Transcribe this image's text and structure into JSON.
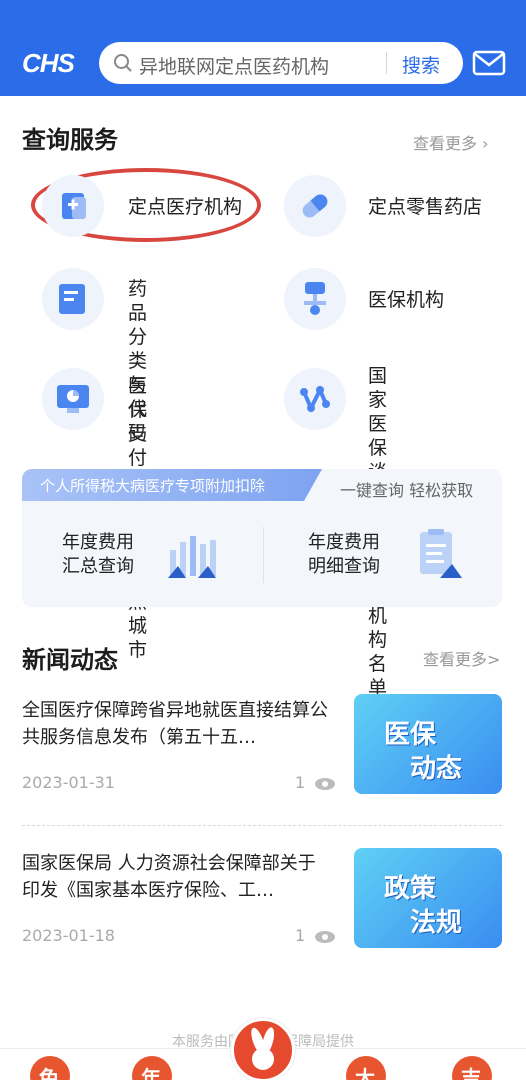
{
  "header": {
    "logo": "CHS",
    "search_placeholder": "异地联网定点医药机构",
    "search_button": "搜索"
  },
  "query": {
    "title": "查询服务",
    "more": "查看更多 ›",
    "items": [
      {
        "label": "定点医疗机构"
      },
      {
        "label": "定点零售药店"
      },
      {
        "label_l1": "药品分类与代",
        "label_l2": "码"
      },
      {
        "label": "医保机构"
      },
      {
        "label_l1": "医保支付方式",
        "label_l2": "改革试点城市"
      },
      {
        "label_l1": "国家医保谈判",
        "label_l2": "药品配备机构",
        "label_l3": "名单查询"
      }
    ]
  },
  "tax": {
    "banner": "个人所得税大病医疗专项附加扣除",
    "sub": "一键查询 轻松获取",
    "items": [
      {
        "l1": "年度费用",
        "l2": "汇总查询"
      },
      {
        "l1": "年度费用",
        "l2": "明细查询"
      }
    ]
  },
  "news": {
    "title": "新闻动态",
    "more": "查看更多>",
    "items": [
      {
        "title": "全国医疗保障跨省异地就医直接结算公共服务信息发布（第五十五…",
        "date": "2023-01-31",
        "views": "1",
        "thumb_l1": "医保",
        "thumb_l2": "动态"
      },
      {
        "title": "国家医保局 人力资源社会保障部关于印发《国家基本医疗保险、工…",
        "date": "2023-01-18",
        "views": "1",
        "thumb_l1": "政策",
        "thumb_l2": "法规"
      }
    ]
  },
  "footer": {
    "note": "本服务由国家医疗保障局提供",
    "tabs": [
      "兔",
      "年",
      "大",
      "吉"
    ]
  },
  "colors": {
    "brand": "#2b6de8",
    "highlight": "#d8473f"
  }
}
